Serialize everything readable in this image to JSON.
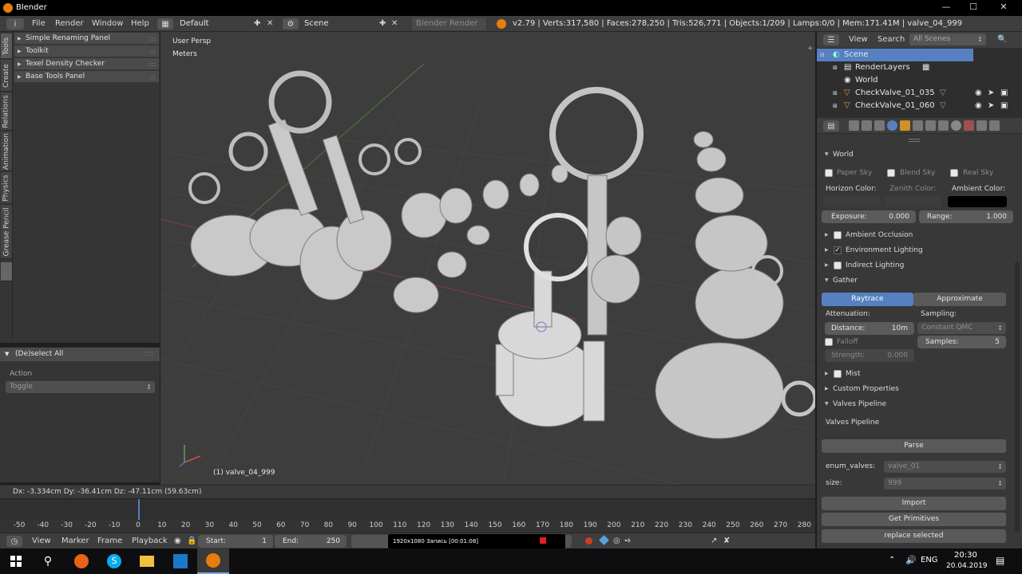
{
  "window": {
    "title": "Blender",
    "minimize": "—",
    "maximize": "☐",
    "close": "✕"
  },
  "top_menu": [
    "File",
    "Render",
    "Window",
    "Help"
  ],
  "layout": {
    "value": "Default"
  },
  "scene": {
    "value": "Scene"
  },
  "render_engine": {
    "value": "Blender Render"
  },
  "stats": "v2.79 | Verts:317,580 | Faces:278,250 | Tris:526,771 | Objects:1/209 | Lamps:0/0 | Mem:171.41M | valve_04_999",
  "tool_tabs": [
    "Tools",
    "Create",
    "Relations",
    "Animation",
    "Physics",
    "Grease Pencil"
  ],
  "tool_panels": [
    "Simple Renaming Panel",
    "Toolkit",
    "Texel Density Checker",
    "Base Tools Panel"
  ],
  "operator": {
    "title": "(De)select All",
    "action_label": "Action",
    "action_value": "Toggle"
  },
  "viewport": {
    "view_label": "User Persp",
    "units_label": "Meters",
    "object_label": "(1) valve_04_999"
  },
  "transform_status": "Dx: -3.334cm  Dy: -36.41cm  Dz: -47.11cm (59.63cm)",
  "timeline": {
    "ruler": [
      "-50",
      "-40",
      "-30",
      "-20",
      "-10",
      "0",
      "10",
      "20",
      "30",
      "40",
      "50",
      "60",
      "70",
      "80",
      "90",
      "100",
      "110",
      "120",
      "130",
      "140",
      "150",
      "160",
      "170",
      "180",
      "190",
      "200",
      "210",
      "220",
      "230",
      "240",
      "250",
      "260",
      "270",
      "280"
    ],
    "current_frame": 0,
    "menu": [
      "View",
      "Marker",
      "Frame",
      "Playback"
    ],
    "start_label": "Start:",
    "start_value": "1",
    "end_label": "End:",
    "end_value": "250",
    "recording": "1920x1080   Запись [00:01:08]"
  },
  "outliner": {
    "view_label": "View",
    "search_label": "Search",
    "filter_value": "All Scenes",
    "rows": [
      "Scene",
      "RenderLayers",
      "World",
      "CheckValve_01_035",
      "CheckValve_01_060"
    ]
  },
  "properties": {
    "world_title": "World",
    "sky": [
      "Paper Sky",
      "Blend Sky",
      "Real Sky"
    ],
    "horizon_color": "Horizon Color:",
    "zenith_color": "Zenith Color:",
    "ambient_color": "Ambient Color:",
    "exposure_label": "Exposure:",
    "exposure_value": "0.000",
    "range_label": "Range:",
    "range_value": "1.000",
    "ambient_occlusion": "Ambient Occlusion",
    "env_lighting": "Environment Lighting",
    "indirect_lighting": "Indirect Lighting",
    "gather": "Gather",
    "raytrace": "Raytrace",
    "approximate": "Approximate",
    "attenuation": "Attenuation:",
    "sampling": "Sampling:",
    "distance_label": "Distance:",
    "distance_value": "10m",
    "sampling_value": "Constant QMC",
    "falloff": "Falloff",
    "samples_label": "Samples:",
    "samples_value": "5",
    "strength_label": "Strength:",
    "strength_value": "0.000",
    "mist": "Mist",
    "custom_props": "Custom Properties",
    "valves_pipeline": "Valves Pipeline",
    "valves_pipeline_label": "Valves Pipeline",
    "parse": "Parse",
    "enum_label": "enum_valves:",
    "enum_value": "valve_01",
    "size_label": "size:",
    "size_value": "999",
    "import": "Import",
    "get_primitives": "Get Primitives",
    "replace_selected": "replace selected"
  },
  "taskbar": {
    "lang": "ENG",
    "time": "20:30",
    "date": "20.04.2019"
  },
  "colors": {
    "accent_blue": "#5680c2",
    "blender_orange": "#e87d0d",
    "selected_row": "#5680c2"
  }
}
